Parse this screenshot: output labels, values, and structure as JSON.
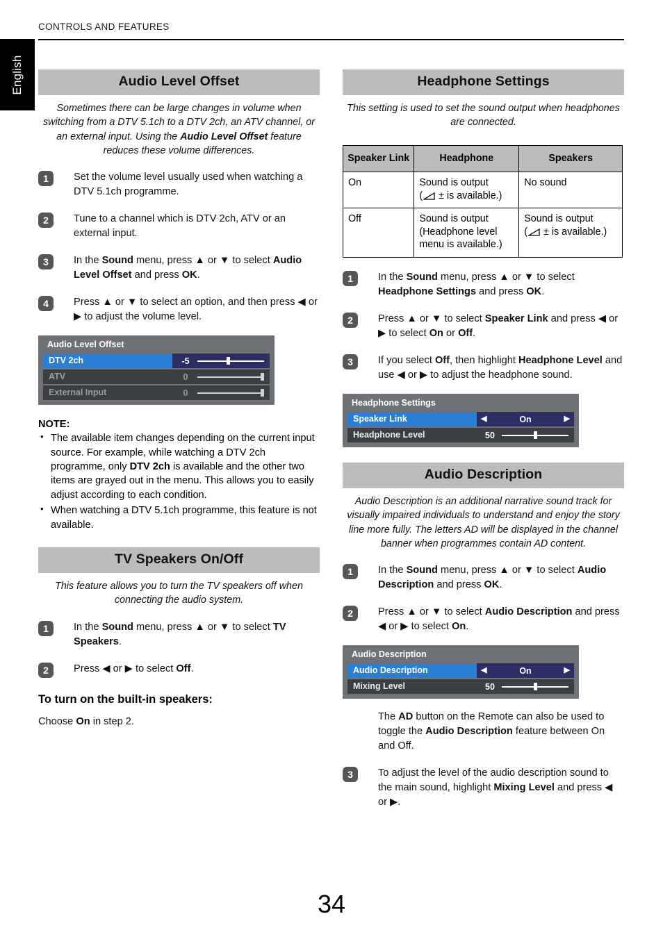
{
  "header": {
    "running_head": "CONTROLS AND FEATURES",
    "language_tab": "English"
  },
  "page_number": "34",
  "colors": {
    "section_bar": "#bcbcbc",
    "badge": "#565656",
    "osd_background": "#6e7276",
    "osd_row": "#3c3f42",
    "osd_selected": "#2a7fd4",
    "osd_selected_value": "#2b2f66"
  },
  "left_column": {
    "section1": {
      "title": "Audio Level Offset",
      "intro_1": "Sometimes there can be large changes in volume when switching from a DTV 5.1ch to a DTV 2ch, an ATV channel, or an external input. Using the ",
      "intro_bold": "Audio Level Offset",
      "intro_2": " feature reduces these volume differences.",
      "steps": [
        {
          "number": "1",
          "parts": [
            {
              "t": "Set the volume level usually used when watching a DTV 5.1ch programme.",
              "b": false
            }
          ]
        },
        {
          "number": "2",
          "parts": [
            {
              "t": "Tune to a channel which is DTV 2ch, ATV or an external input.",
              "b": false
            }
          ]
        },
        {
          "number": "3",
          "parts": [
            {
              "t": "In the ",
              "b": false
            },
            {
              "t": "Sound",
              "b": true
            },
            {
              "t": " menu, press ▲ or ▼ to select ",
              "b": false
            },
            {
              "t": "Audio Level Offset",
              "b": true
            },
            {
              "t": " and press ",
              "b": false
            },
            {
              "t": "OK",
              "b": true
            },
            {
              "t": ".",
              "b": false
            }
          ]
        },
        {
          "number": "4",
          "parts": [
            {
              "t": "Press ▲ or ▼ to select an option, and then press ◀ or ▶ to adjust the volume level.",
              "b": false
            }
          ]
        }
      ],
      "osd": {
        "title": "Audio Level Offset",
        "rows": [
          {
            "label": "DTV 2ch",
            "value": "-5",
            "state": "selected",
            "knob_pct": 46
          },
          {
            "label": "ATV",
            "value": "0",
            "state": "dim",
            "knob_pct": 97
          },
          {
            "label": "External Input",
            "value": "0",
            "state": "dim",
            "knob_pct": 97
          }
        ]
      },
      "note_title": "NOTE:",
      "notes": [
        {
          "parts": [
            {
              "t": "The available item changes depending on the current input source. For example, while watching a DTV 2ch programme, only ",
              "b": false
            },
            {
              "t": "DTV 2ch",
              "b": true
            },
            {
              "t": " is available and the other two items are grayed out in the menu. This allows you to easily adjust according to each condition.",
              "b": false
            }
          ]
        },
        {
          "parts": [
            {
              "t": "When watching a DTV 5.1ch programme, this feature is not available.",
              "b": false
            }
          ]
        }
      ]
    },
    "section2": {
      "title": "TV Speakers On/Off",
      "intro": "This feature allows you to turn the TV speakers off when connecting the audio system.",
      "steps": [
        {
          "number": "1",
          "parts": [
            {
              "t": "In the ",
              "b": false
            },
            {
              "t": "Sound",
              "b": true
            },
            {
              "t": " menu, press ▲ or ▼ to select ",
              "b": false
            },
            {
              "t": "TV Speakers",
              "b": true
            },
            {
              "t": ".",
              "b": false
            }
          ]
        },
        {
          "number": "2",
          "parts": [
            {
              "t": "Press ◀ or ▶ to select ",
              "b": false
            },
            {
              "t": "Off",
              "b": true
            },
            {
              "t": ".",
              "b": false
            }
          ]
        }
      ],
      "subhead": "To turn on the built-in speakers:",
      "after_sub": [
        {
          "t": "Choose ",
          "b": false
        },
        {
          "t": "On",
          "b": true
        },
        {
          "t": " in step 2.",
          "b": false
        }
      ]
    }
  },
  "right_column": {
    "section1": {
      "title": "Headphone Settings",
      "intro": "This setting is used to set the sound output when headphones are connected.",
      "table": {
        "headers": [
          "Speaker Link",
          "Headphone",
          "Speakers"
        ],
        "rows": [
          {
            "link": "On",
            "headphone": [
              " Sound is output",
              "(◸ ± is available.)"
            ],
            "speakers": [
              "No sound"
            ]
          },
          {
            "link": "Off",
            "headphone": [
              "Sound is output",
              "(Headphone level",
              "menu is available.)"
            ],
            "speakers": [
              "Sound is output",
              "(◸ ± is available.)"
            ]
          }
        ]
      },
      "steps": [
        {
          "number": "1",
          "parts": [
            {
              "t": "In the ",
              "b": false
            },
            {
              "t": "Sound",
              "b": true
            },
            {
              "t": " menu, press ▲ or ▼ to select ",
              "b": false
            },
            {
              "t": "Headphone Settings",
              "b": true
            },
            {
              "t": " and press ",
              "b": false
            },
            {
              "t": "OK",
              "b": true
            },
            {
              "t": ".",
              "b": false
            }
          ]
        },
        {
          "number": "2",
          "parts": [
            {
              "t": "Press ▲ or ▼ to select ",
              "b": false
            },
            {
              "t": "Speaker Link",
              "b": true
            },
            {
              "t": " and press ◀ or ▶ to select ",
              "b": false
            },
            {
              "t": "On",
              "b": true
            },
            {
              "t": " or ",
              "b": false
            },
            {
              "t": "Off",
              "b": true
            },
            {
              "t": ".",
              "b": false
            }
          ]
        },
        {
          "number": "3",
          "parts": [
            {
              "t": "If you select ",
              "b": false
            },
            {
              "t": "Off",
              "b": true
            },
            {
              "t": ", then highlight ",
              "b": false
            },
            {
              "t": "Headphone Level",
              "b": true
            },
            {
              "t": " and use ◀ or ▶ to adjust the headphone sound.",
              "b": false
            }
          ]
        }
      ],
      "osd": {
        "title": "Headphone Settings",
        "rows": [
          {
            "label": "Speaker Link",
            "value": "On",
            "state": "selected",
            "kind": "option"
          },
          {
            "label": "Headphone Level",
            "value": "50",
            "state": "normal",
            "kind": "slider",
            "knob_pct": 50
          }
        ]
      }
    },
    "section2": {
      "title": "Audio Description",
      "intro": "Audio Description is an additional narrative sound track for visually impaired individuals to understand and enjoy the story line more fully. The letters AD will be displayed in the channel banner when programmes contain AD content.",
      "steps": [
        {
          "number": "1",
          "parts": [
            {
              "t": "In the ",
              "b": false
            },
            {
              "t": "Sound",
              "b": true
            },
            {
              "t": " menu, press ▲ or ▼ to select ",
              "b": false
            },
            {
              "t": "Audio Description",
              "b": true
            },
            {
              "t": " and press ",
              "b": false
            },
            {
              "t": "OK",
              "b": true
            },
            {
              "t": ".",
              "b": false
            }
          ]
        },
        {
          "number": "2",
          "parts": [
            {
              "t": "Press ▲ or ▼ to select ",
              "b": false
            },
            {
              "t": "Audio Description",
              "b": true
            },
            {
              "t": " and press ◀ or ▶ to select ",
              "b": false
            },
            {
              "t": "On",
              "b": true
            },
            {
              "t": ".",
              "b": false
            }
          ]
        }
      ],
      "osd": {
        "title": "Audio Description",
        "rows": [
          {
            "label": "Audio Description",
            "value": "On",
            "state": "selected",
            "kind": "option"
          },
          {
            "label": "Mixing Level",
            "value": "50",
            "state": "normal",
            "kind": "slider",
            "knob_pct": 50
          }
        ]
      },
      "after_osd": [
        {
          "t": "The ",
          "b": false
        },
        {
          "t": "AD",
          "b": true
        },
        {
          "t": " button on the Remote can also be used to toggle the ",
          "b": false
        },
        {
          "t": "Audio Description",
          "b": true
        },
        {
          "t": " feature between On and Off.",
          "b": false
        }
      ],
      "last_step": {
        "number": "3",
        "parts": [
          {
            "t": "To adjust the level of the audio description sound to the main sound, highlight ",
            "b": false
          },
          {
            "t": "Mixing Level",
            "b": true
          },
          {
            "t": " and press ◀ or ▶.",
            "b": false
          }
        ]
      }
    }
  }
}
